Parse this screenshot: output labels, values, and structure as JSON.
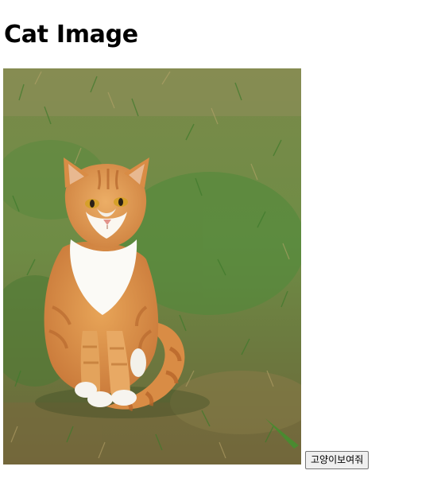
{
  "page": {
    "title": "Cat Image"
  },
  "image": {
    "subject": "cat-photo"
  },
  "button": {
    "label": "고양이보여줘"
  }
}
